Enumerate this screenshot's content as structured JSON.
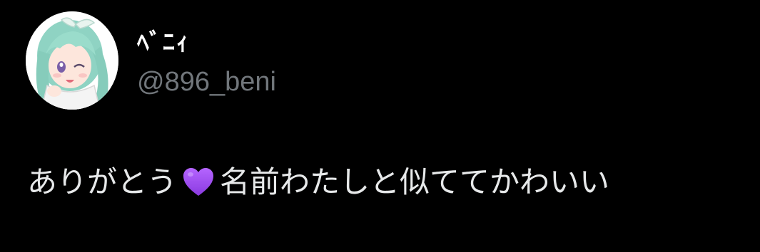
{
  "user": {
    "display_name": "ﾍﾞﾆｨ",
    "handle": "@896_beni",
    "avatar_icon": "anime-girl-avatar-icon"
  },
  "tweet": {
    "text_before": "ありがとう",
    "emoji": "purple-heart-icon",
    "text_after": "名前わたしと似ててかわいい"
  },
  "colors": {
    "background": "#000000",
    "handle": "#71767b",
    "text": "#e7e9ea",
    "heart": "#a24cf0"
  }
}
